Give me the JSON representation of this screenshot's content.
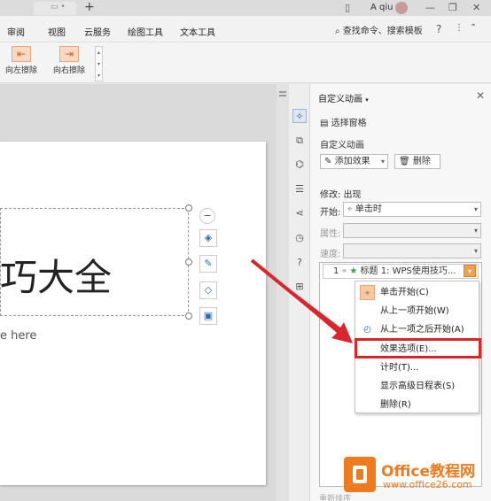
{
  "titlebar": {
    "user_name": "A qiu"
  },
  "menubar": {
    "items": [
      "审阅",
      "视图",
      "云服务",
      "绘图工具",
      "文本工具"
    ],
    "search_label": "查找命令、搜索模板",
    "help_label": "?"
  },
  "ribbon": {
    "wipe_left_label": "向左擦除",
    "wipe_right_label": "向右擦除"
  },
  "slide": {
    "title_text": "巧大全",
    "subtitle_text": "e here"
  },
  "pane": {
    "title": "自定义动画",
    "selection_pane": "选择窗格",
    "section_title": "自定义动画",
    "add_effect": "添加效果",
    "delete": "删除",
    "modify_label": "修改: 出现",
    "start_label": "开始:",
    "start_value": "单击时",
    "property_label": "属性:",
    "speed_label": "速度:",
    "anim_item": {
      "index": "1",
      "text": "标题 1: WPS使用技巧..."
    },
    "footer": "重新排序"
  },
  "context_menu": {
    "items": [
      {
        "label": "单击开始(C)",
        "icon": "mouse-icon"
      },
      {
        "label": "从上一项开始(W)",
        "icon": "none"
      },
      {
        "label": "从上一项之后开始(A)",
        "icon": "clock-icon"
      },
      {
        "label": "效果选项(E)...",
        "icon": "none"
      },
      {
        "label": "计时(T)...",
        "icon": "none"
      },
      {
        "label": "显示高级日程表(S)",
        "icon": "none"
      },
      {
        "label": "删除(R)",
        "icon": "none"
      }
    ],
    "highlighted_index": 3,
    "highlight_color": "#d9262b"
  },
  "watermark": {
    "brand": "Office教程网",
    "url": "www.office26.com",
    "color": "#f07a1e"
  },
  "colors": {
    "accent_orange": "#e07a2e",
    "arrow_red": "#d9262b"
  }
}
